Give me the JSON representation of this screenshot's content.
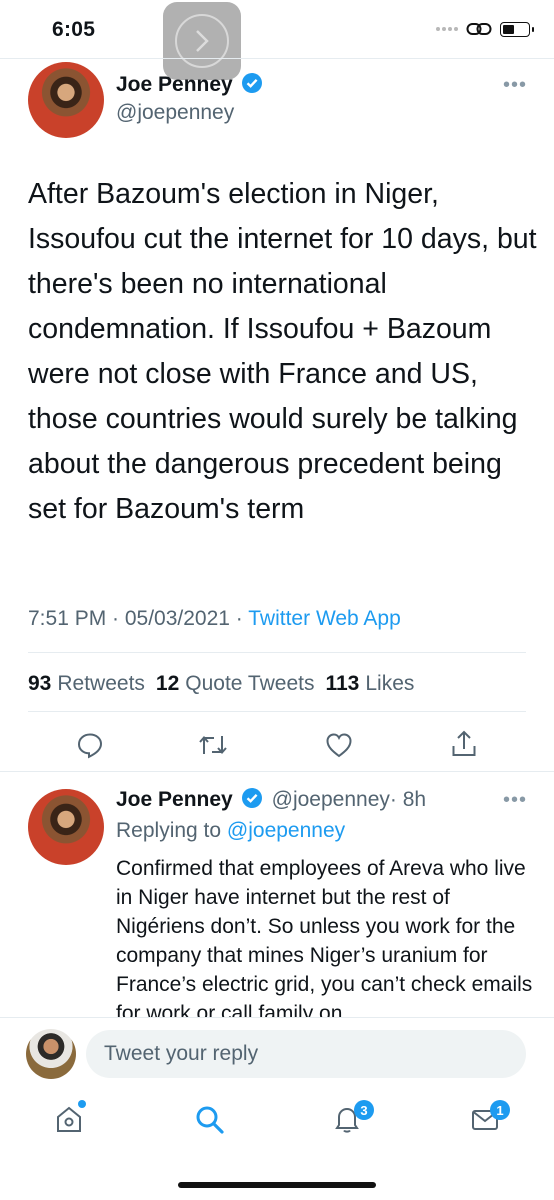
{
  "status_bar": {
    "time": "6:05"
  },
  "tweet": {
    "author_name": "Joe Penney",
    "author_handle": "@joepenney",
    "more_label": "•••",
    "text": "After Bazoum's election in Niger, Issoufou cut the internet for 10 days, but there's been no international condemnation. If Issoufou + Bazoum were not close with France and US, those countries would surely be talking about the dangerous precedent being set for Bazoum's term",
    "timestamp": "7:51 PM · 05/03/2021 · ",
    "source_app": "Twitter Web App",
    "stats": {
      "retweets_count": "93",
      "retweets_label": "Retweets",
      "quotes_count": "12",
      "quotes_label": "Quote Tweets",
      "likes_count": "113",
      "likes_label": "Likes"
    }
  },
  "reply": {
    "author_name": "Joe Penney",
    "author_handle": "@joepenney",
    "time": "· 8h",
    "replying_prefix": "Replying to ",
    "replying_to": "@joepenney",
    "more_label": "•••",
    "text": "Confirmed that employees of Areva who live in Niger have internet but the rest of Nigériens don’t. So unless you work for the company that mines Niger’s uranium for France’s electric grid, you can’t check emails for work or call family on"
  },
  "composer": {
    "placeholder": "Tweet your reply"
  },
  "tab_bar": {
    "notifications_badge": "3",
    "messages_badge": "1"
  },
  "colors": {
    "accent": "#1d9bf0",
    "secondary_text": "#536471",
    "divider": "#e6ecf0"
  },
  "icons": [
    "forward-chevron-icon",
    "link-icon",
    "verified-badge-icon",
    "reply-icon",
    "retweet-icon",
    "like-icon",
    "share-icon",
    "home-icon",
    "search-icon",
    "notifications-icon",
    "messages-icon"
  ]
}
